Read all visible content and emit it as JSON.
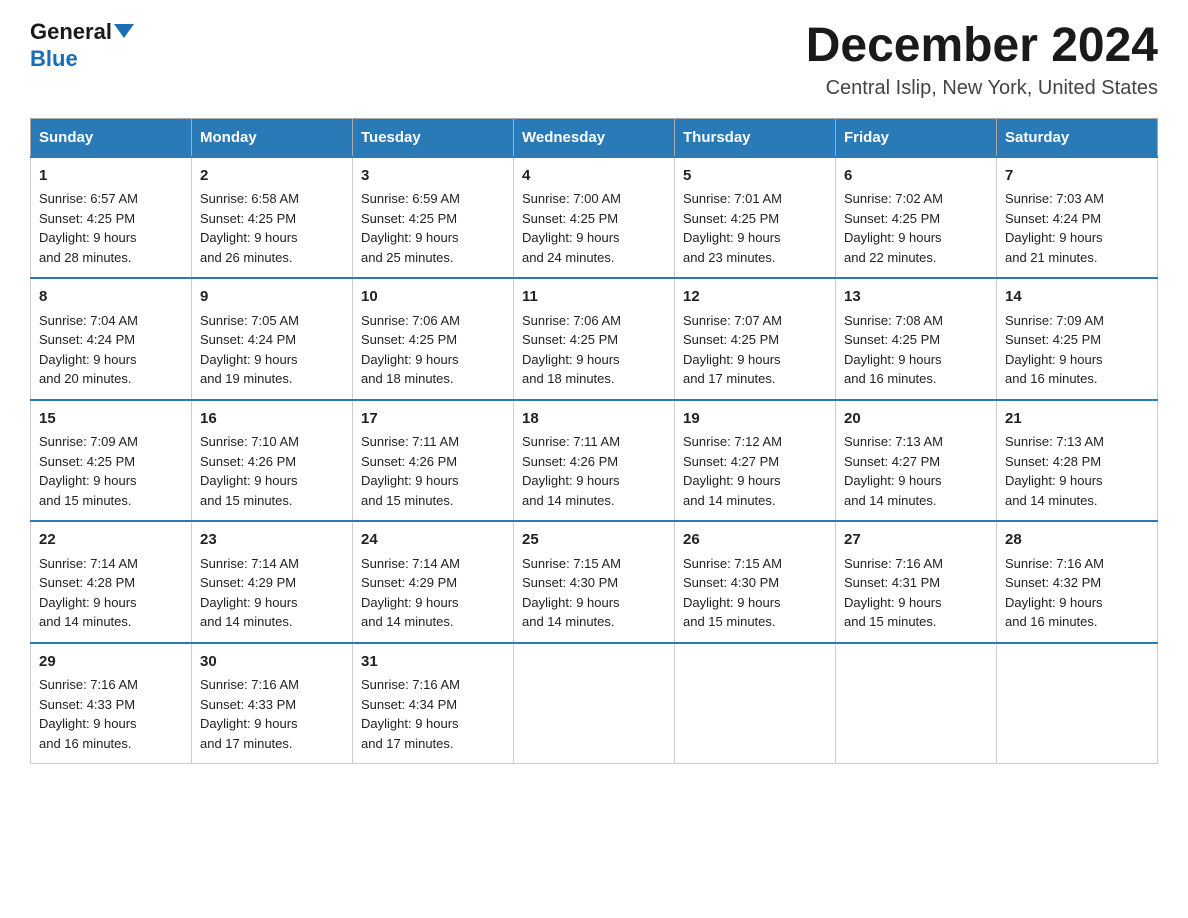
{
  "header": {
    "logo_line1": "General",
    "logo_line2": "Blue",
    "month_title": "December 2024",
    "location": "Central Islip, New York, United States"
  },
  "weekdays": [
    "Sunday",
    "Monday",
    "Tuesday",
    "Wednesday",
    "Thursday",
    "Friday",
    "Saturday"
  ],
  "weeks": [
    [
      {
        "day": "1",
        "sunrise": "6:57 AM",
        "sunset": "4:25 PM",
        "daylight": "9 hours and 28 minutes."
      },
      {
        "day": "2",
        "sunrise": "6:58 AM",
        "sunset": "4:25 PM",
        "daylight": "9 hours and 26 minutes."
      },
      {
        "day": "3",
        "sunrise": "6:59 AM",
        "sunset": "4:25 PM",
        "daylight": "9 hours and 25 minutes."
      },
      {
        "day": "4",
        "sunrise": "7:00 AM",
        "sunset": "4:25 PM",
        "daylight": "9 hours and 24 minutes."
      },
      {
        "day": "5",
        "sunrise": "7:01 AM",
        "sunset": "4:25 PM",
        "daylight": "9 hours and 23 minutes."
      },
      {
        "day": "6",
        "sunrise": "7:02 AM",
        "sunset": "4:25 PM",
        "daylight": "9 hours and 22 minutes."
      },
      {
        "day": "7",
        "sunrise": "7:03 AM",
        "sunset": "4:24 PM",
        "daylight": "9 hours and 21 minutes."
      }
    ],
    [
      {
        "day": "8",
        "sunrise": "7:04 AM",
        "sunset": "4:24 PM",
        "daylight": "9 hours and 20 minutes."
      },
      {
        "day": "9",
        "sunrise": "7:05 AM",
        "sunset": "4:24 PM",
        "daylight": "9 hours and 19 minutes."
      },
      {
        "day": "10",
        "sunrise": "7:06 AM",
        "sunset": "4:25 PM",
        "daylight": "9 hours and 18 minutes."
      },
      {
        "day": "11",
        "sunrise": "7:06 AM",
        "sunset": "4:25 PM",
        "daylight": "9 hours and 18 minutes."
      },
      {
        "day": "12",
        "sunrise": "7:07 AM",
        "sunset": "4:25 PM",
        "daylight": "9 hours and 17 minutes."
      },
      {
        "day": "13",
        "sunrise": "7:08 AM",
        "sunset": "4:25 PM",
        "daylight": "9 hours and 16 minutes."
      },
      {
        "day": "14",
        "sunrise": "7:09 AM",
        "sunset": "4:25 PM",
        "daylight": "9 hours and 16 minutes."
      }
    ],
    [
      {
        "day": "15",
        "sunrise": "7:09 AM",
        "sunset": "4:25 PM",
        "daylight": "9 hours and 15 minutes."
      },
      {
        "day": "16",
        "sunrise": "7:10 AM",
        "sunset": "4:26 PM",
        "daylight": "9 hours and 15 minutes."
      },
      {
        "day": "17",
        "sunrise": "7:11 AM",
        "sunset": "4:26 PM",
        "daylight": "9 hours and 15 minutes."
      },
      {
        "day": "18",
        "sunrise": "7:11 AM",
        "sunset": "4:26 PM",
        "daylight": "9 hours and 14 minutes."
      },
      {
        "day": "19",
        "sunrise": "7:12 AM",
        "sunset": "4:27 PM",
        "daylight": "9 hours and 14 minutes."
      },
      {
        "day": "20",
        "sunrise": "7:13 AM",
        "sunset": "4:27 PM",
        "daylight": "9 hours and 14 minutes."
      },
      {
        "day": "21",
        "sunrise": "7:13 AM",
        "sunset": "4:28 PM",
        "daylight": "9 hours and 14 minutes."
      }
    ],
    [
      {
        "day": "22",
        "sunrise": "7:14 AM",
        "sunset": "4:28 PM",
        "daylight": "9 hours and 14 minutes."
      },
      {
        "day": "23",
        "sunrise": "7:14 AM",
        "sunset": "4:29 PM",
        "daylight": "9 hours and 14 minutes."
      },
      {
        "day": "24",
        "sunrise": "7:14 AM",
        "sunset": "4:29 PM",
        "daylight": "9 hours and 14 minutes."
      },
      {
        "day": "25",
        "sunrise": "7:15 AM",
        "sunset": "4:30 PM",
        "daylight": "9 hours and 14 minutes."
      },
      {
        "day": "26",
        "sunrise": "7:15 AM",
        "sunset": "4:30 PM",
        "daylight": "9 hours and 15 minutes."
      },
      {
        "day": "27",
        "sunrise": "7:16 AM",
        "sunset": "4:31 PM",
        "daylight": "9 hours and 15 minutes."
      },
      {
        "day": "28",
        "sunrise": "7:16 AM",
        "sunset": "4:32 PM",
        "daylight": "9 hours and 16 minutes."
      }
    ],
    [
      {
        "day": "29",
        "sunrise": "7:16 AM",
        "sunset": "4:33 PM",
        "daylight": "9 hours and 16 minutes."
      },
      {
        "day": "30",
        "sunrise": "7:16 AM",
        "sunset": "4:33 PM",
        "daylight": "9 hours and 17 minutes."
      },
      {
        "day": "31",
        "sunrise": "7:16 AM",
        "sunset": "4:34 PM",
        "daylight": "9 hours and 17 minutes."
      },
      null,
      null,
      null,
      null
    ]
  ]
}
